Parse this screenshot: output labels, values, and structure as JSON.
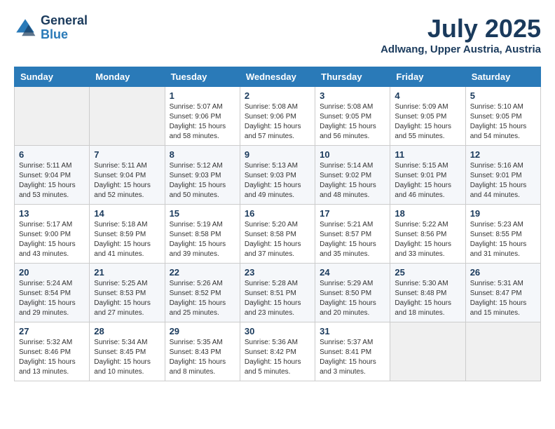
{
  "logo": {
    "line1": "General",
    "line2": "Blue"
  },
  "title": "July 2025",
  "location": "Adlwang, Upper Austria, Austria",
  "days_of_week": [
    "Sunday",
    "Monday",
    "Tuesday",
    "Wednesday",
    "Thursday",
    "Friday",
    "Saturday"
  ],
  "weeks": [
    [
      {
        "day": "",
        "info": ""
      },
      {
        "day": "",
        "info": ""
      },
      {
        "day": "1",
        "info": "Sunrise: 5:07 AM\nSunset: 9:06 PM\nDaylight: 15 hours and 58 minutes."
      },
      {
        "day": "2",
        "info": "Sunrise: 5:08 AM\nSunset: 9:06 PM\nDaylight: 15 hours and 57 minutes."
      },
      {
        "day": "3",
        "info": "Sunrise: 5:08 AM\nSunset: 9:05 PM\nDaylight: 15 hours and 56 minutes."
      },
      {
        "day": "4",
        "info": "Sunrise: 5:09 AM\nSunset: 9:05 PM\nDaylight: 15 hours and 55 minutes."
      },
      {
        "day": "5",
        "info": "Sunrise: 5:10 AM\nSunset: 9:05 PM\nDaylight: 15 hours and 54 minutes."
      }
    ],
    [
      {
        "day": "6",
        "info": "Sunrise: 5:11 AM\nSunset: 9:04 PM\nDaylight: 15 hours and 53 minutes."
      },
      {
        "day": "7",
        "info": "Sunrise: 5:11 AM\nSunset: 9:04 PM\nDaylight: 15 hours and 52 minutes."
      },
      {
        "day": "8",
        "info": "Sunrise: 5:12 AM\nSunset: 9:03 PM\nDaylight: 15 hours and 50 minutes."
      },
      {
        "day": "9",
        "info": "Sunrise: 5:13 AM\nSunset: 9:03 PM\nDaylight: 15 hours and 49 minutes."
      },
      {
        "day": "10",
        "info": "Sunrise: 5:14 AM\nSunset: 9:02 PM\nDaylight: 15 hours and 48 minutes."
      },
      {
        "day": "11",
        "info": "Sunrise: 5:15 AM\nSunset: 9:01 PM\nDaylight: 15 hours and 46 minutes."
      },
      {
        "day": "12",
        "info": "Sunrise: 5:16 AM\nSunset: 9:01 PM\nDaylight: 15 hours and 44 minutes."
      }
    ],
    [
      {
        "day": "13",
        "info": "Sunrise: 5:17 AM\nSunset: 9:00 PM\nDaylight: 15 hours and 43 minutes."
      },
      {
        "day": "14",
        "info": "Sunrise: 5:18 AM\nSunset: 8:59 PM\nDaylight: 15 hours and 41 minutes."
      },
      {
        "day": "15",
        "info": "Sunrise: 5:19 AM\nSunset: 8:58 PM\nDaylight: 15 hours and 39 minutes."
      },
      {
        "day": "16",
        "info": "Sunrise: 5:20 AM\nSunset: 8:58 PM\nDaylight: 15 hours and 37 minutes."
      },
      {
        "day": "17",
        "info": "Sunrise: 5:21 AM\nSunset: 8:57 PM\nDaylight: 15 hours and 35 minutes."
      },
      {
        "day": "18",
        "info": "Sunrise: 5:22 AM\nSunset: 8:56 PM\nDaylight: 15 hours and 33 minutes."
      },
      {
        "day": "19",
        "info": "Sunrise: 5:23 AM\nSunset: 8:55 PM\nDaylight: 15 hours and 31 minutes."
      }
    ],
    [
      {
        "day": "20",
        "info": "Sunrise: 5:24 AM\nSunset: 8:54 PM\nDaylight: 15 hours and 29 minutes."
      },
      {
        "day": "21",
        "info": "Sunrise: 5:25 AM\nSunset: 8:53 PM\nDaylight: 15 hours and 27 minutes."
      },
      {
        "day": "22",
        "info": "Sunrise: 5:26 AM\nSunset: 8:52 PM\nDaylight: 15 hours and 25 minutes."
      },
      {
        "day": "23",
        "info": "Sunrise: 5:28 AM\nSunset: 8:51 PM\nDaylight: 15 hours and 23 minutes."
      },
      {
        "day": "24",
        "info": "Sunrise: 5:29 AM\nSunset: 8:50 PM\nDaylight: 15 hours and 20 minutes."
      },
      {
        "day": "25",
        "info": "Sunrise: 5:30 AM\nSunset: 8:48 PM\nDaylight: 15 hours and 18 minutes."
      },
      {
        "day": "26",
        "info": "Sunrise: 5:31 AM\nSunset: 8:47 PM\nDaylight: 15 hours and 15 minutes."
      }
    ],
    [
      {
        "day": "27",
        "info": "Sunrise: 5:32 AM\nSunset: 8:46 PM\nDaylight: 15 hours and 13 minutes."
      },
      {
        "day": "28",
        "info": "Sunrise: 5:34 AM\nSunset: 8:45 PM\nDaylight: 15 hours and 10 minutes."
      },
      {
        "day": "29",
        "info": "Sunrise: 5:35 AM\nSunset: 8:43 PM\nDaylight: 15 hours and 8 minutes."
      },
      {
        "day": "30",
        "info": "Sunrise: 5:36 AM\nSunset: 8:42 PM\nDaylight: 15 hours and 5 minutes."
      },
      {
        "day": "31",
        "info": "Sunrise: 5:37 AM\nSunset: 8:41 PM\nDaylight: 15 hours and 3 minutes."
      },
      {
        "day": "",
        "info": ""
      },
      {
        "day": "",
        "info": ""
      }
    ]
  ]
}
